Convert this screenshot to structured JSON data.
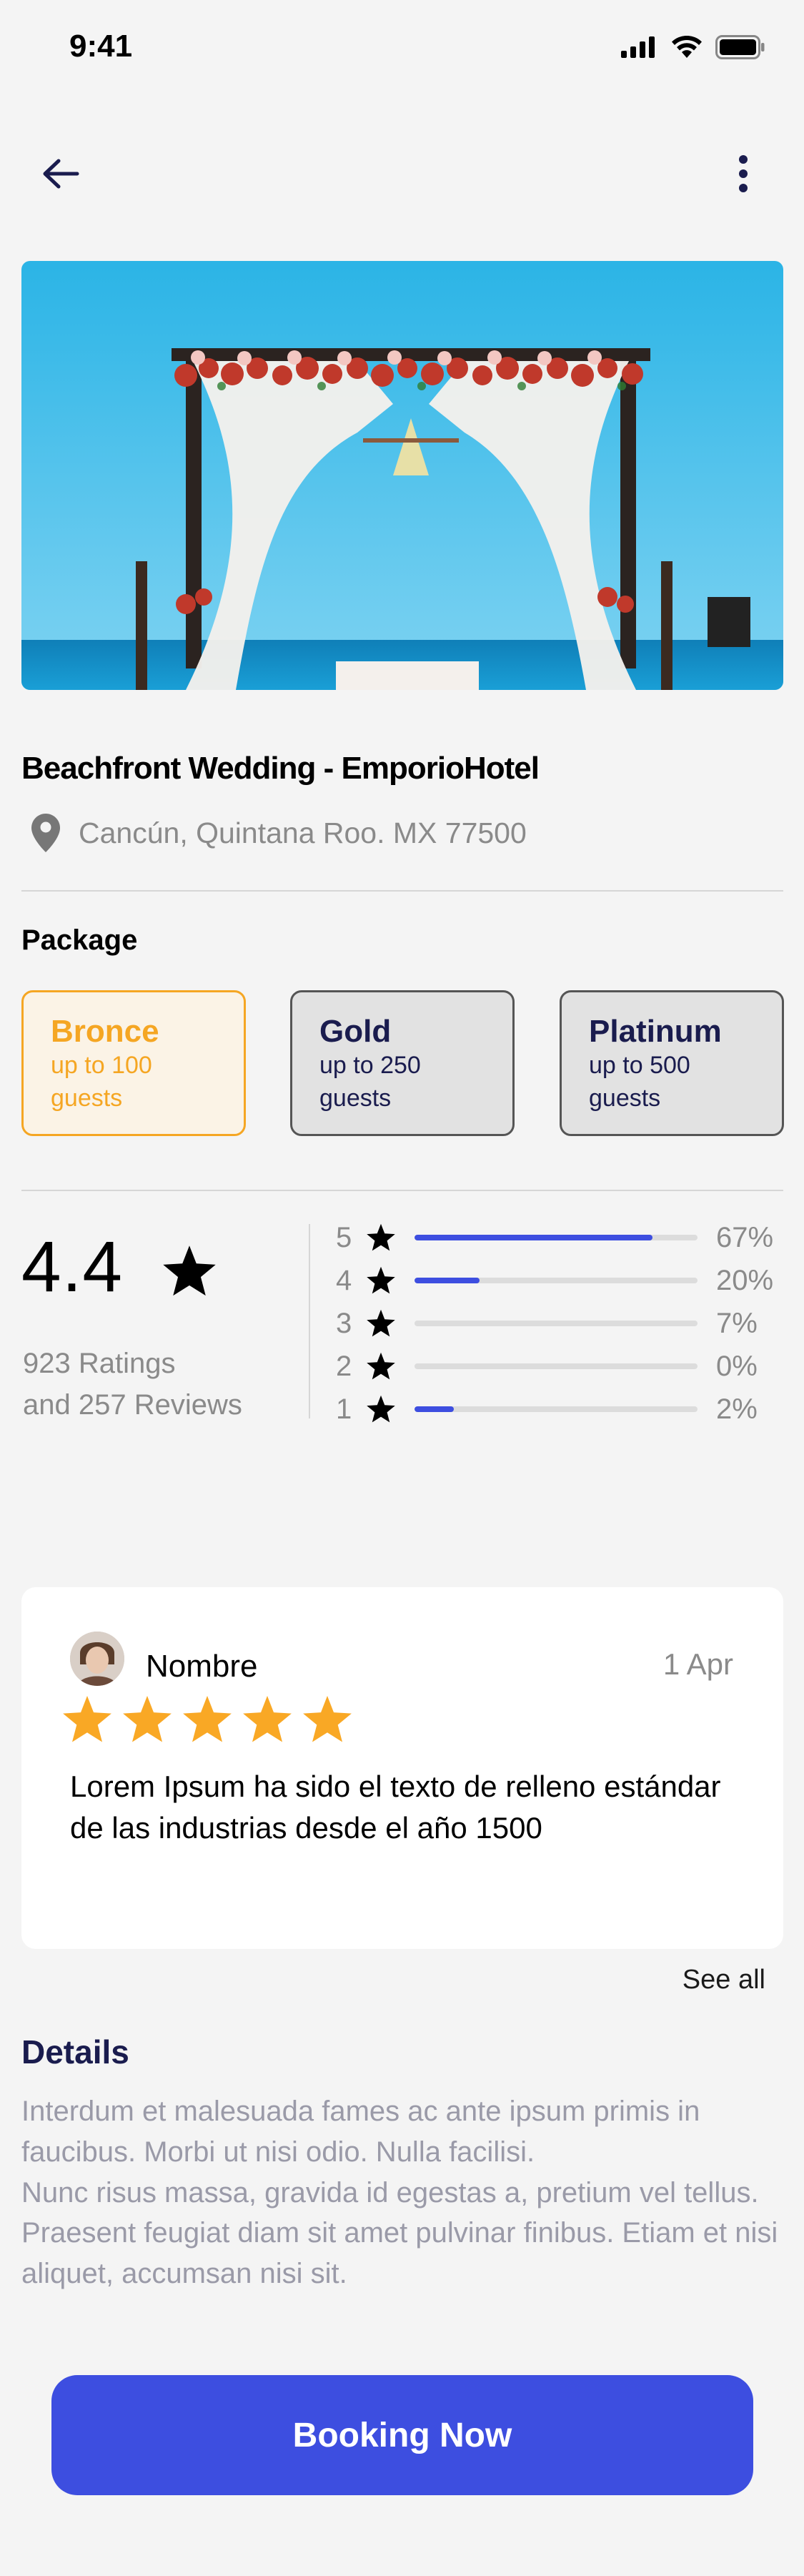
{
  "status_bar": {
    "time": "9:41",
    "icons": [
      "signal-icon",
      "wifi-icon",
      "battery-icon"
    ]
  },
  "nav": {
    "back_icon": "arrow-left-icon",
    "more_icon": "more-vertical-icon"
  },
  "hero": {
    "alt": "Beach wedding arch with flowers"
  },
  "venue": {
    "title": "Beachfront Wedding - EmporioHotel",
    "location": "Cancún, Quintana Roo. MX 77500"
  },
  "package": {
    "label": "Package",
    "options": [
      {
        "name": "Bronce",
        "desc_line1": "up to 100",
        "desc_line2": "guests",
        "selected": true
      },
      {
        "name": "Gold",
        "desc_line1": "up to 250",
        "desc_line2": "guests",
        "selected": false
      },
      {
        "name": "Platinum",
        "desc_line1": "up to 500",
        "desc_line2": "guests",
        "selected": false
      }
    ]
  },
  "rating": {
    "average": "4.4",
    "count_line1": "923 Ratings",
    "count_line2": "and 257 Reviews",
    "breakdown": [
      {
        "stars": "5",
        "percent_label": "67%",
        "fill": 0.84
      },
      {
        "stars": "4",
        "percent_label": "20%",
        "fill": 0.23
      },
      {
        "stars": "3",
        "percent_label": "7%",
        "fill": 0
      },
      {
        "stars": "2",
        "percent_label": "0%",
        "fill": 0
      },
      {
        "stars": "1",
        "percent_label": "2%",
        "fill": 0.14
      }
    ]
  },
  "review": {
    "name": "Nombre",
    "date": "1 Apr",
    "stars": 5,
    "text": "Lorem Ipsum ha sido el texto de relleno estándar de las industrias desde el año 1500"
  },
  "see_all": "See all",
  "details": {
    "title": "Details",
    "text_p1": "Interdum et malesuada fames ac ante ipsum primis in faucibus. Morbi ut nisi odio. Nulla facilisi.",
    "text_p2": "Nunc risus massa, gravida id egestas a, pretium vel tellus. Praesent feugiat diam sit amet pulvinar finibus. Etiam et nisi aliquet, accumsan nisi sit."
  },
  "cta": {
    "label": "Booking Now"
  },
  "colors": {
    "accent": "#3d4ee0",
    "bronze": "#f5a623",
    "navy": "#1a1c4e",
    "muted": "#8a8a8a",
    "star_gold": "#f9a825"
  }
}
